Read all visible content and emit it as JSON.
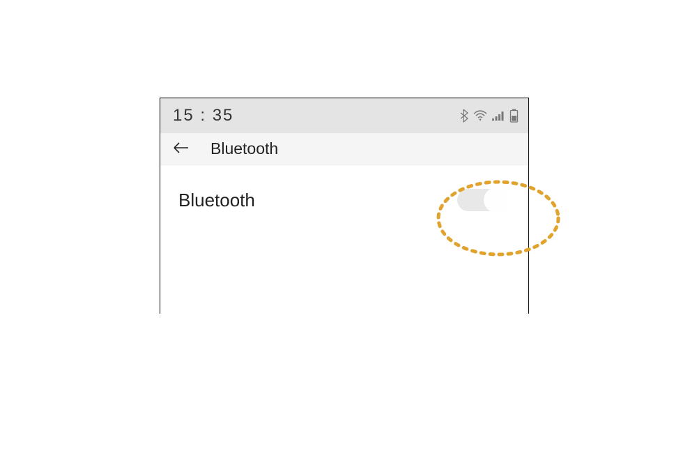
{
  "statusBar": {
    "time": "15 : 35"
  },
  "navBar": {
    "title": "Bluetooth"
  },
  "setting": {
    "label": "Bluetooth",
    "toggleState": "on"
  }
}
